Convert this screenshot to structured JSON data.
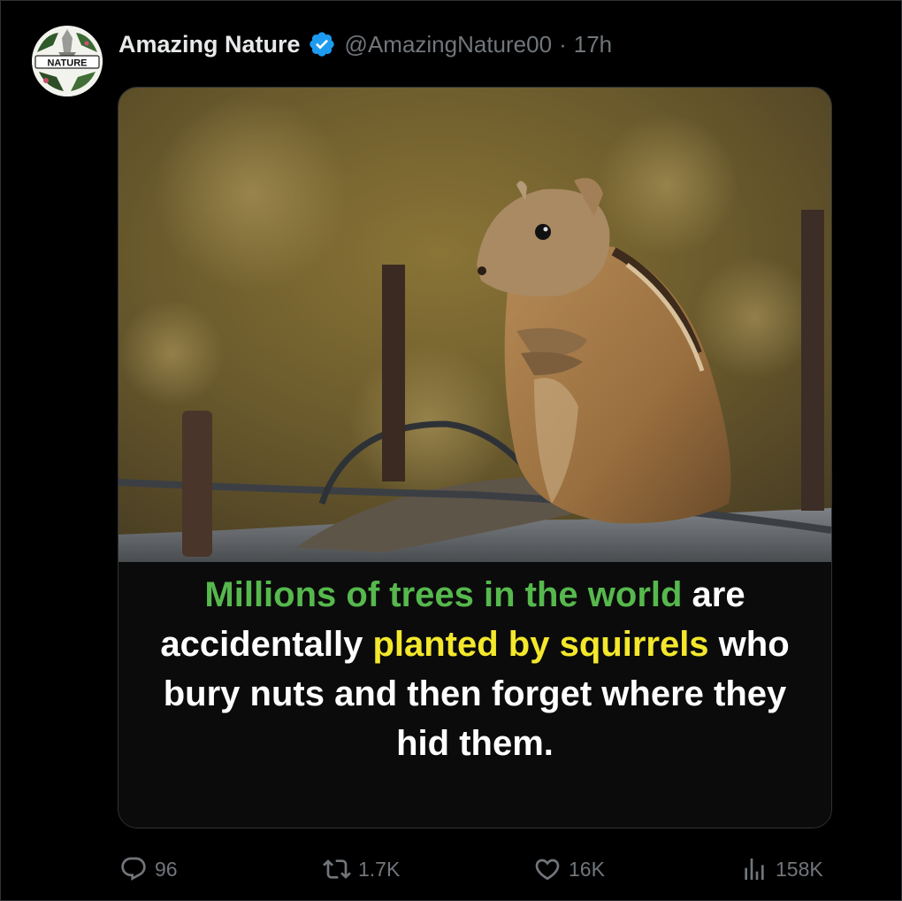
{
  "author": {
    "display_name": "Amazing Nature",
    "handle": "@AmazingNature00",
    "separator": "·",
    "time": "17h",
    "avatar_label": "NATURE",
    "verified_color": "#1d9bf0"
  },
  "media": {
    "caption_parts": {
      "part1": "Millions of trees in the world",
      "part2": " are accidentally ",
      "part3": "planted by squirrels",
      "part4": " who bury nuts and then forget where they hid them."
    },
    "highlight_green": "#56b84d",
    "highlight_yellow": "#f3e82b"
  },
  "actions": {
    "replies": "96",
    "reposts": "1.7K",
    "likes": "16K",
    "views": "158K"
  }
}
